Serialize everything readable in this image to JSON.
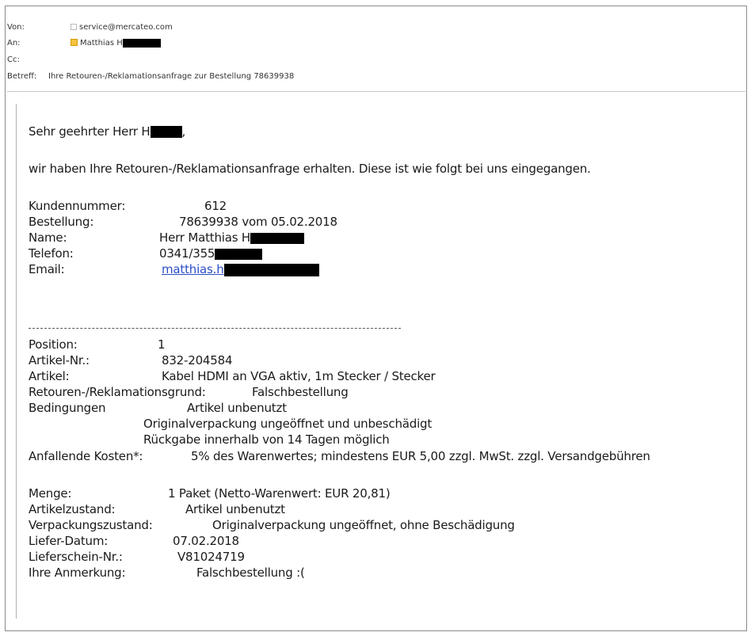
{
  "header": {
    "from_label": "Von:",
    "from_value": "service@mercateo.com",
    "to_label": "An:",
    "to_value": "Matthias H",
    "cc_label": "Cc:",
    "subject_label": "Betreff:",
    "subject_value": "Ihre Retouren-/Reklamationsanfrage zur Bestellung 78639938"
  },
  "body": {
    "greeting": "Sehr geehrter Herr H",
    "greeting_tail": ",",
    "intro": "wir haben Ihre Retouren-/Reklamationsanfrage erhalten. Diese ist wie folgt bei uns eingegangen.",
    "customer": [
      {
        "label": "Kundennummer:",
        "value": "612"
      },
      {
        "label": "Bestellung:",
        "value": "78639938 vom 05.02.2018"
      },
      {
        "label": "Name:",
        "value": "Herr Matthias H"
      },
      {
        "label": "Telefon:",
        "value": "0341/355"
      },
      {
        "label": "Email:",
        "value": "matthias.h"
      }
    ],
    "position_label": "Position:",
    "position_value": "1",
    "artnr_label": "Artikel-Nr.:",
    "artnr_value": "832-204584",
    "article_label": "Artikel:",
    "article_value": "Kabel HDMI an VGA aktiv, 1m Stecker / Stecker",
    "reason_label": "Retouren-/Reklamationsgrund:",
    "reason_value": "Falschbestellung",
    "conditions_label": "Bedingungen",
    "conditions": [
      "Artikel unbenutzt",
      "Originalverpackung ungeöffnet und unbeschädigt",
      "Rückgabe innerhalb von 14 Tagen möglich"
    ],
    "costs_label": "Anfallende Kosten*:",
    "costs_value": "5% des Warenwertes; mindestens  EUR 5,00 zzgl. MwSt. zzgl. Versandgebühren",
    "qty_label": "Menge:",
    "qty_value": "1 Paket (Netto-Warenwert: EUR 20,81)",
    "state_label": "Artikelzustand:",
    "state_value": "Artikel unbenutzt",
    "pack_label": "Verpackungszustand:",
    "pack_value": "Originalverpackung ungeöffnet, ohne Beschädigung",
    "delivery_label": "Liefer-Datum:",
    "delivery_value": "07.02.2018",
    "slip_label": "Lieferschein-Nr.:",
    "slip_value": "V81024719",
    "note_label": "Ihre Anmerkung:",
    "note_value": "Falschbestellung :("
  }
}
